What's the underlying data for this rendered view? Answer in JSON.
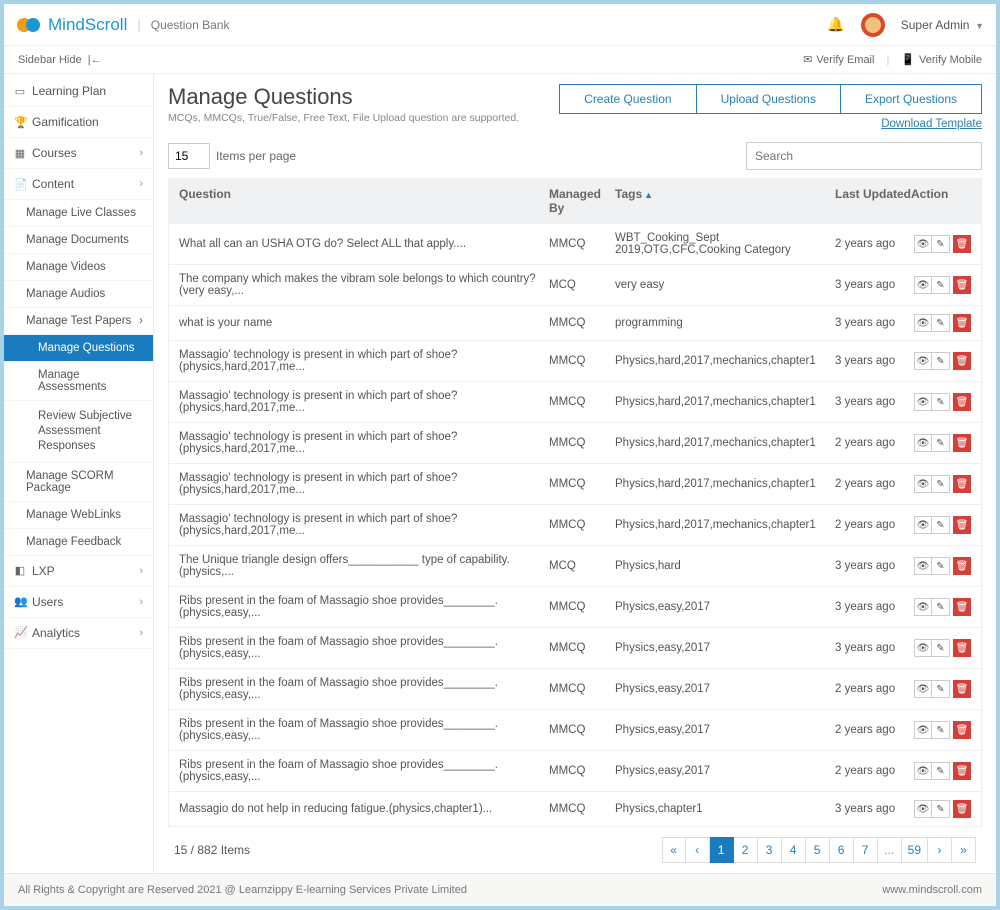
{
  "header": {
    "brand": "MindScroll",
    "breadcrumb": "Question Bank",
    "user_label": "Super Admin",
    "sidebar_hide": "Sidebar Hide",
    "verify_email": "Verify Email",
    "verify_mobile": "Verify Mobile"
  },
  "sidebar": {
    "items": [
      {
        "label": "Learning Plan"
      },
      {
        "label": "Gamification"
      },
      {
        "label": "Courses"
      },
      {
        "label": "Content"
      },
      {
        "label": "LXP"
      },
      {
        "label": "Users"
      },
      {
        "label": "Analytics"
      }
    ],
    "content_children": [
      {
        "label": "Manage Live Classes"
      },
      {
        "label": "Manage Documents"
      },
      {
        "label": "Manage Videos"
      },
      {
        "label": "Manage Audios"
      },
      {
        "label": "Manage Test Papers"
      },
      {
        "label": "Manage SCORM Package"
      },
      {
        "label": "Manage WebLinks"
      },
      {
        "label": "Manage Feedback"
      }
    ],
    "test_children": [
      {
        "label": "Manage Questions"
      },
      {
        "label": "Manage Assessments"
      },
      {
        "label": "Review Subjective Assessment Responses"
      }
    ]
  },
  "page": {
    "title": "Manage Questions",
    "subtitle": "MCQs, MMCQs, True/False, Free Text, File Upload question are supported.",
    "actions": {
      "create": "Create Question",
      "upload": "Upload Questions",
      "export": "Export Questions"
    },
    "download_template": "Download Template",
    "items_per_page_value": "15",
    "items_per_page_label": "Items per page",
    "search_placeholder": "Search",
    "count_label": "15 / 882 Items"
  },
  "table": {
    "headers": {
      "question": "Question",
      "managed_by": "Managed By",
      "tags": "Tags",
      "last_updated": "Last Updated",
      "action": "Action"
    },
    "rows": [
      {
        "q": "What all can an USHA OTG do? Select ALL that apply....",
        "m": "MMCQ",
        "t": "WBT_Cooking_Sept 2019,OTG,CFC,Cooking Category",
        "u": "2 years ago"
      },
      {
        "q": "The company which makes the vibram sole belongs to which country?(very easy,...",
        "m": "MCQ",
        "t": "very easy",
        "u": "3 years ago"
      },
      {
        "q": "what is your name",
        "m": "MMCQ",
        "t": "programming",
        "u": "3 years ago"
      },
      {
        "q": "Massagio' technology is present in which part of shoe?(physics,hard,2017,me...",
        "m": "MMCQ",
        "t": "Physics,hard,2017,mechanics,chapter1",
        "u": "3 years ago"
      },
      {
        "q": "Massagio' technology is present in which part of shoe?(physics,hard,2017,me...",
        "m": "MMCQ",
        "t": "Physics,hard,2017,mechanics,chapter1",
        "u": "3 years ago"
      },
      {
        "q": "Massagio' technology is present in which part of shoe?(physics,hard,2017,me...",
        "m": "MMCQ",
        "t": "Physics,hard,2017,mechanics,chapter1",
        "u": "2 years ago"
      },
      {
        "q": "Massagio' technology is present in which part of shoe?(physics,hard,2017,me...",
        "m": "MMCQ",
        "t": "Physics,hard,2017,mechanics,chapter1",
        "u": "2 years ago"
      },
      {
        "q": "Massagio' technology is present in which part of shoe?(physics,hard,2017,me...",
        "m": "MMCQ",
        "t": "Physics,hard,2017,mechanics,chapter1",
        "u": "2 years ago"
      },
      {
        "q": "The Unique triangle design offers___________ type of capability.(physics,...",
        "m": "MCQ",
        "t": "Physics,hard",
        "u": "3 years ago"
      },
      {
        "q": "Ribs present in the foam of Massagio shoe provides________. (physics,easy,...",
        "m": "MMCQ",
        "t": "Physics,easy,2017",
        "u": "3 years ago"
      },
      {
        "q": "Ribs present in the foam of Massagio shoe provides________. (physics,easy,...",
        "m": "MMCQ",
        "t": "Physics,easy,2017",
        "u": "3 years ago"
      },
      {
        "q": "Ribs present in the foam of Massagio shoe provides________. (physics,easy,...",
        "m": "MMCQ",
        "t": "Physics,easy,2017",
        "u": "2 years ago"
      },
      {
        "q": "Ribs present in the foam of Massagio shoe provides________. (physics,easy,...",
        "m": "MMCQ",
        "t": "Physics,easy,2017",
        "u": "2 years ago"
      },
      {
        "q": "Ribs present in the foam of Massagio shoe provides________. (physics,easy,...",
        "m": "MMCQ",
        "t": "Physics,easy,2017",
        "u": "2 years ago"
      },
      {
        "q": "Massagio do not help in reducing fatigue.(physics,chapter1)...",
        "m": "MMCQ",
        "t": "Physics,chapter1",
        "u": "3 years ago"
      }
    ]
  },
  "pagination": {
    "pages": [
      "«",
      "‹",
      "1",
      "2",
      "3",
      "4",
      "5",
      "6",
      "7",
      "...",
      "59",
      "›",
      "»"
    ],
    "active": "1"
  },
  "footer": {
    "left": "All Rights & Copyright are Reserved 2021 @ Learnzippy E-learning Services Private Limited",
    "right": "www.mindscroll.com"
  }
}
